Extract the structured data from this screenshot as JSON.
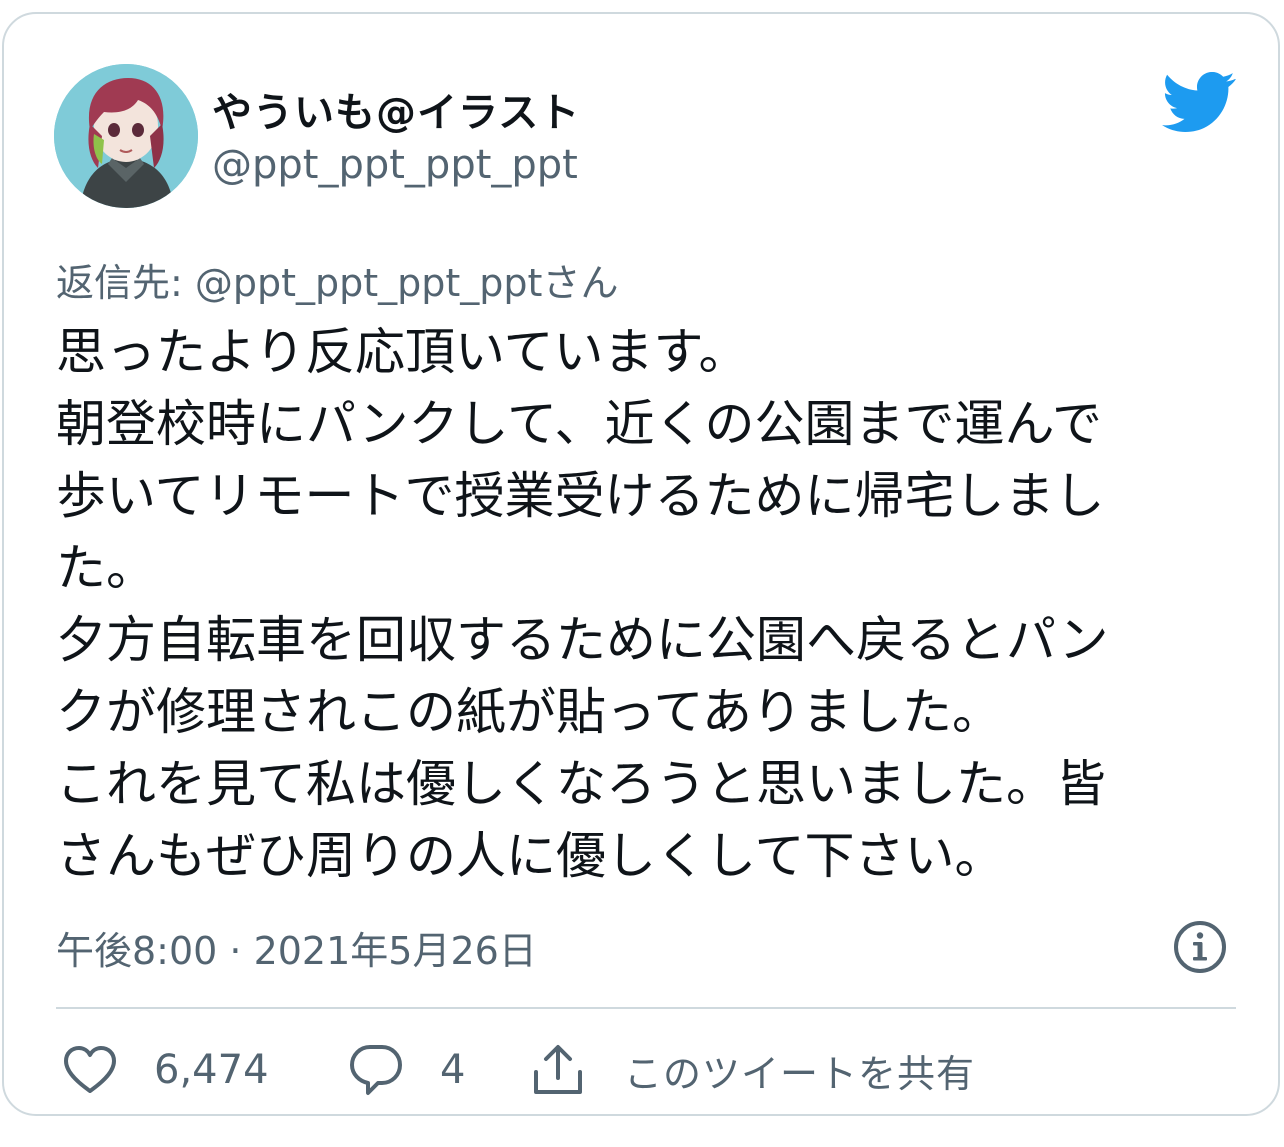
{
  "author": {
    "display_name": "やういも@イラスト",
    "handle": "@ppt_ppt_ppt_ppt",
    "avatar_icon": "user-avatar-illustration"
  },
  "brand": {
    "logo_icon": "twitter-bird-icon",
    "logo_color": "#1d9bf0"
  },
  "tweet": {
    "reply_to": "返信先: @ppt_ppt_ppt_pptさん",
    "text_lines": [
      "思ったより反応頂いています。",
      "朝登校時にパンクして、近くの公園まで運んで",
      "歩いてリモートで授業受けるために帰宅しまし",
      "た。",
      "夕方自転車を回収するために公園へ戻るとパン",
      "クが修理されこの紙が貼ってありました。",
      "これを見て私は優しくなろうと思いました。皆",
      "さんもぜひ周りの人に優しくして下さい。"
    ],
    "timestamp": "午後8:00 · 2021年5月26日",
    "info_icon": "info-icon"
  },
  "actions": {
    "like_count": "6,474",
    "like_icon": "heart-icon",
    "reply_count": "4",
    "reply_icon": "speech-bubble-icon",
    "share_label": "このツイートを共有",
    "share_icon": "share-icon"
  },
  "colors": {
    "text_primary": "#0f1419",
    "text_secondary": "#536471",
    "border": "#cfd9de"
  }
}
